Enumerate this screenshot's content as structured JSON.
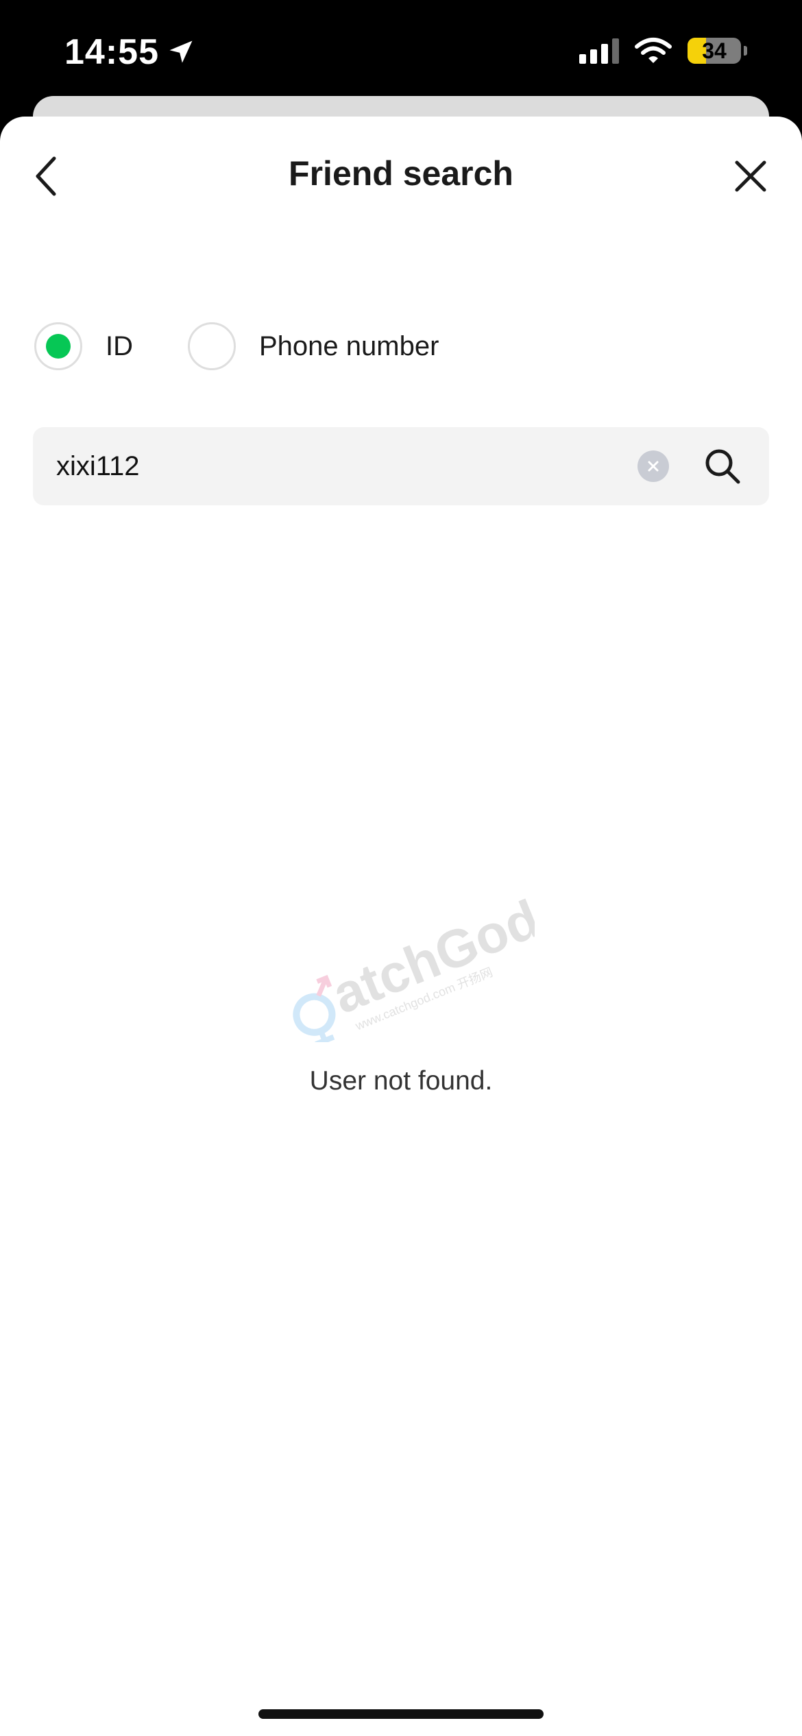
{
  "status_bar": {
    "time": "14:55",
    "battery_level": "34"
  },
  "header": {
    "title": "Friend search"
  },
  "search_type": {
    "options": [
      {
        "label": "ID",
        "selected": true
      },
      {
        "label": "Phone number",
        "selected": false
      }
    ]
  },
  "search": {
    "value": "xixi112"
  },
  "result": {
    "message": "User not found."
  },
  "colors": {
    "accent": "#06c755",
    "input_bg": "#f3f3f3",
    "clear_icon_bg": "#c9ccd4",
    "battery_fill": "#f5d10a"
  },
  "icons": {
    "back": "chevron-left-icon",
    "close": "close-icon",
    "clear": "clear-icon",
    "search": "search-icon",
    "location": "location-arrow-icon"
  },
  "watermark": {
    "text": "CatchGod",
    "subtext": "www.catchgod.com 开扬网"
  }
}
